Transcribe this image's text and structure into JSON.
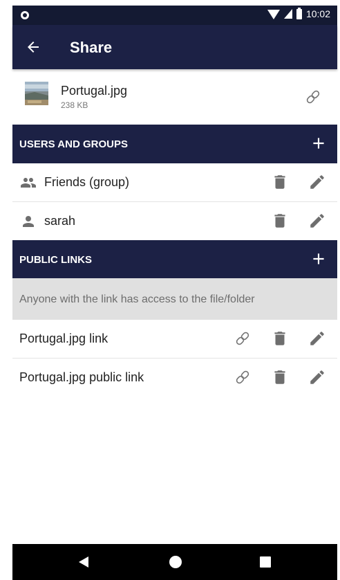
{
  "status_bar": {
    "time": "10:02"
  },
  "app_bar": {
    "title": "Share",
    "back_icon": "arrow-left-icon"
  },
  "file": {
    "name": "Portugal.jpg",
    "size": "238 KB"
  },
  "users_section": {
    "label": "USERS AND GROUPS",
    "items": [
      {
        "label": "Friends (group)",
        "icon": "group-icon"
      },
      {
        "label": "sarah",
        "icon": "person-icon"
      }
    ]
  },
  "links_section": {
    "label": "PUBLIC LINKS",
    "info": "Anyone with the link has access to the file/folder",
    "items": [
      {
        "label": "Portugal.jpg link"
      },
      {
        "label": "Portugal.jpg public link"
      }
    ]
  },
  "colors": {
    "app_bar": "#1c2145",
    "status_bar": "#141a33",
    "icon_gray": "#6e6e6e",
    "info_bg": "#e0e0e0"
  }
}
